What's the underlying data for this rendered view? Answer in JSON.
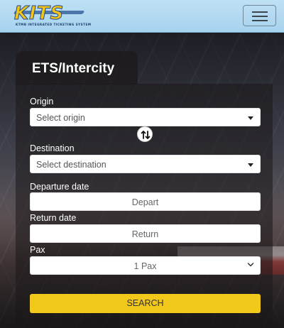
{
  "header": {
    "logo_text": "KITS",
    "logo_subtitle": "KTMB INTEGRATED TICKETING SYSTEM",
    "menu_icon": "hamburger-menu-icon"
  },
  "form": {
    "tab_title": "ETS/Intercity",
    "origin": {
      "label": "Origin",
      "placeholder": "Select origin"
    },
    "swap_icon": "swap-vertical-icon",
    "destination": {
      "label": "Destination",
      "placeholder": "Select destination"
    },
    "departure": {
      "label": "Departure date",
      "placeholder": "Depart"
    },
    "return": {
      "label": "Return date",
      "placeholder": "Return"
    },
    "pax": {
      "label": "Pax",
      "value": "1 Pax"
    },
    "search_label": "SEARCH"
  },
  "colors": {
    "header_bg": "#a7d3ef",
    "search_button": "#f2c81b",
    "logo_yellow": "#f2c318",
    "logo_blue": "#1e4c8a"
  }
}
